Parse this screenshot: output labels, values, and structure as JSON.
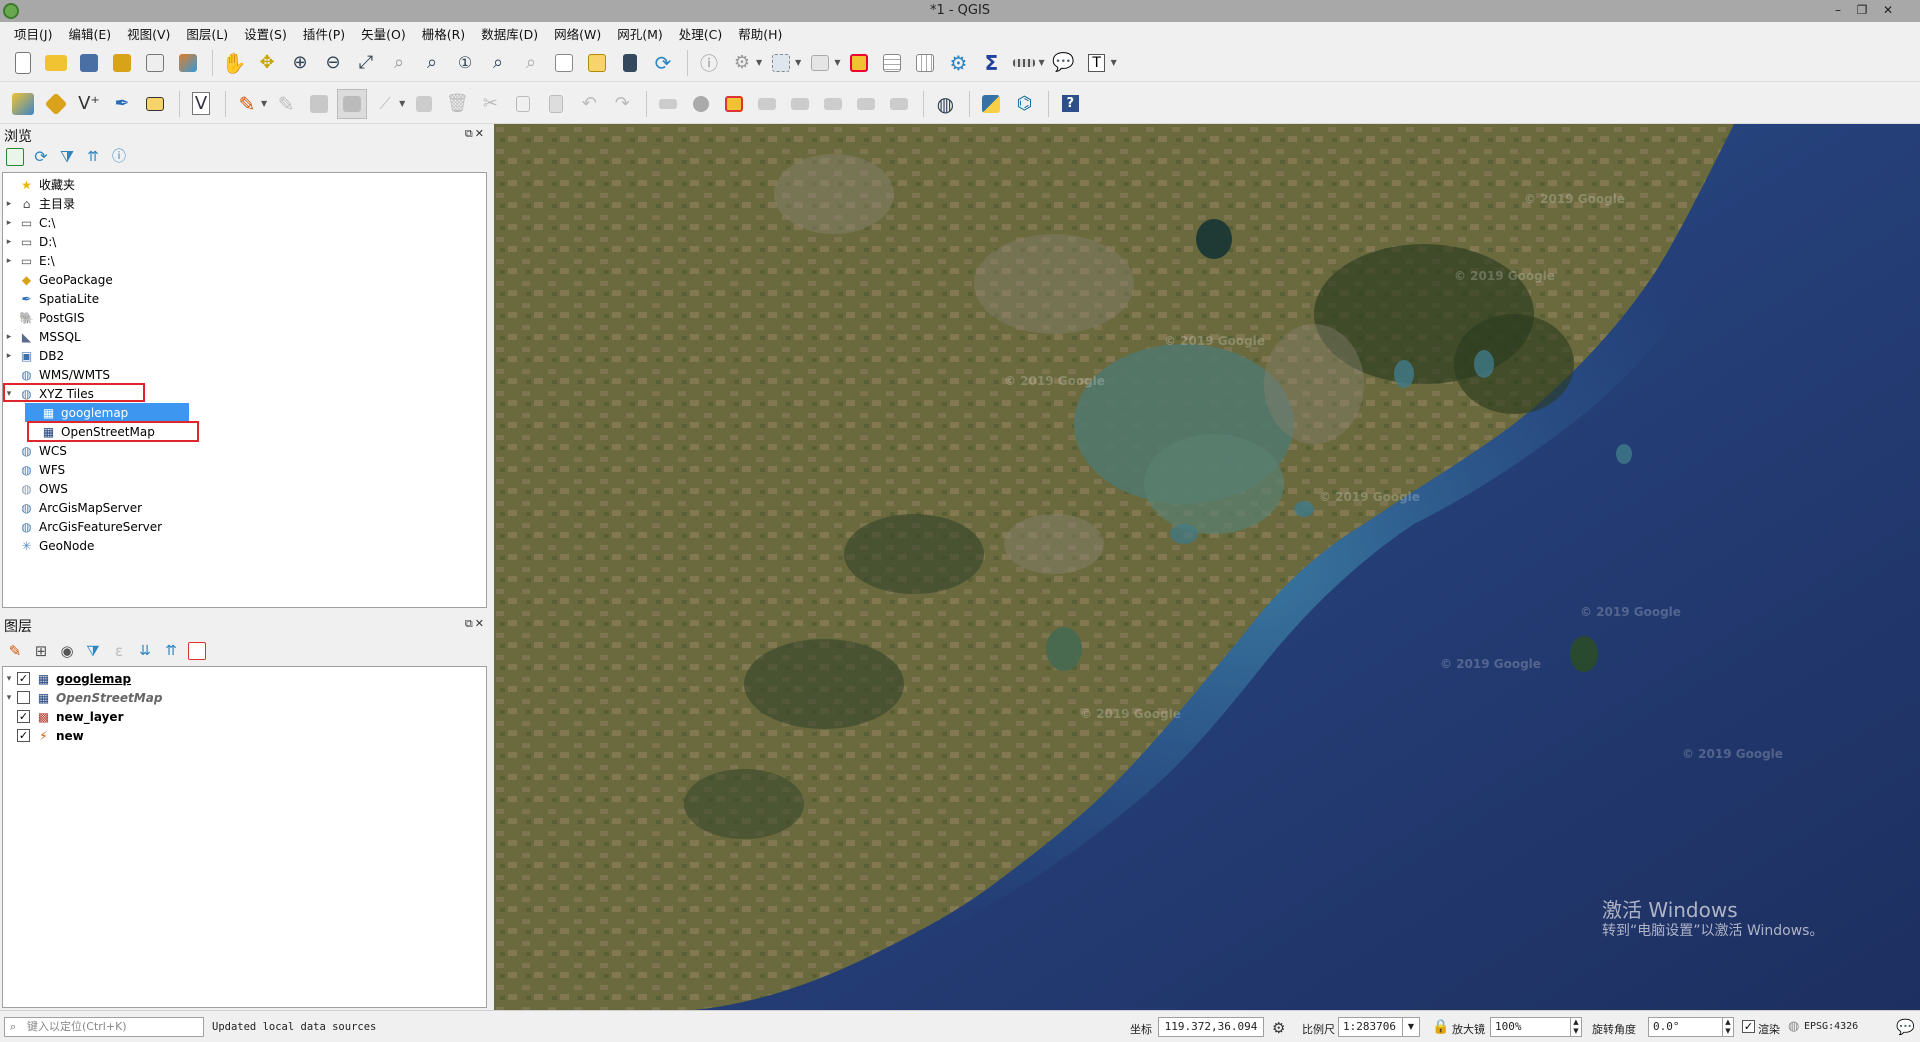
{
  "window": {
    "title": "*1 - QGIS",
    "minimize": "–",
    "restore": "❐",
    "close": "✕"
  },
  "menu": [
    "项目(J)",
    "编辑(E)",
    "视图(V)",
    "图层(L)",
    "设置(S)",
    "插件(P)",
    "矢量(O)",
    "栅格(R)",
    "数据库(D)",
    "网络(W)",
    "网孔(M)",
    "处理(C)",
    "帮助(H)"
  ],
  "browser": {
    "title": "浏览",
    "controls": "⧉✕",
    "items": [
      {
        "label": "收藏夹",
        "icon": "star-icon",
        "glyph": "★",
        "color": "#e6b800",
        "arrow": ""
      },
      {
        "label": "主目录",
        "icon": "home-folder-icon",
        "glyph": "⌂",
        "color": "#555",
        "arrow": "▸"
      },
      {
        "label": "C:\\",
        "icon": "folder-icon",
        "glyph": "▭",
        "color": "#555",
        "arrow": "▸"
      },
      {
        "label": "D:\\",
        "icon": "folder-icon",
        "glyph": "▭",
        "color": "#555",
        "arrow": "▸"
      },
      {
        "label": "E:\\",
        "icon": "folder-icon",
        "glyph": "▭",
        "color": "#555",
        "arrow": "▸"
      },
      {
        "label": "GeoPackage",
        "icon": "geopackage-icon",
        "glyph": "◆",
        "color": "#d9a21b",
        "arrow": ""
      },
      {
        "label": "SpatiaLite",
        "icon": "spatialite-icon",
        "glyph": "✒",
        "color": "#2a6bb5",
        "arrow": ""
      },
      {
        "label": "PostGIS",
        "icon": "postgis-icon",
        "glyph": "🐘",
        "color": "#336791",
        "arrow": ""
      },
      {
        "label": "MSSQL",
        "icon": "mssql-icon",
        "glyph": "◣",
        "color": "#5a6b8c",
        "arrow": "▸"
      },
      {
        "label": "DB2",
        "icon": "db2-icon",
        "glyph": "▣",
        "color": "#3a6fb0",
        "arrow": "▸"
      },
      {
        "label": "WMS/WMTS",
        "icon": "globe-icon",
        "glyph": "◍",
        "color": "#4a7fb5",
        "arrow": ""
      },
      {
        "label": "XYZ Tiles",
        "icon": "globe-icon",
        "glyph": "◍",
        "color": "#4a7fb5",
        "arrow": "▾"
      },
      {
        "label": "googlemap",
        "icon": "tile-layer-icon",
        "glyph": "▦",
        "color": "#1c3f7a",
        "arrow": "",
        "indent": 1
      },
      {
        "label": "OpenStreetMap",
        "icon": "tile-layer-icon",
        "glyph": "▦",
        "color": "#1c3f7a",
        "arrow": "",
        "indent": 1
      },
      {
        "label": "WCS",
        "icon": "globe-icon",
        "glyph": "◍",
        "color": "#4a7fb5",
        "arrow": ""
      },
      {
        "label": "WFS",
        "icon": "globe-icon",
        "glyph": "◍",
        "color": "#4a7fb5",
        "arrow": ""
      },
      {
        "label": "OWS",
        "icon": "globe-icon",
        "glyph": "◍",
        "color": "#8a9cb0",
        "arrow": ""
      },
      {
        "label": "ArcGisMapServer",
        "icon": "globe-icon",
        "glyph": "◍",
        "color": "#4a7fb5",
        "arrow": ""
      },
      {
        "label": "ArcGisFeatureServer",
        "icon": "globe-icon",
        "glyph": "◍",
        "color": "#4a7fb5",
        "arrow": ""
      },
      {
        "label": "GeoNode",
        "icon": "geonode-icon",
        "glyph": "✳",
        "color": "#5a8fc8",
        "arrow": ""
      }
    ]
  },
  "layers": {
    "title": "图层",
    "controls": "⧉✕",
    "items": [
      {
        "label": "googlemap",
        "checked": true,
        "icon": "tile-layer-icon",
        "glyph": "▦",
        "color": "#1c3f7a",
        "bold": true,
        "underline": true,
        "italic": false,
        "arrow": "▾"
      },
      {
        "label": "OpenStreetMap",
        "checked": false,
        "icon": "tile-layer-icon",
        "glyph": "▦",
        "color": "#1c3f7a",
        "bold": true,
        "underline": false,
        "italic": true,
        "arrow": "▾"
      },
      {
        "label": "new_layer",
        "checked": true,
        "icon": "polygon-layer-icon",
        "glyph": "▩",
        "color": "#b03a2e",
        "bold": true,
        "underline": false,
        "italic": false,
        "arrow": ""
      },
      {
        "label": "new",
        "checked": true,
        "icon": "line-layer-icon",
        "glyph": "⚡",
        "color": "#d35400",
        "bold": true,
        "underline": false,
        "italic": false,
        "arrow": ""
      }
    ]
  },
  "map": {
    "watermarks": [
      "© 2019 Google",
      "© 2019 Google",
      "© 2019 Google",
      "© 2019 Google",
      "© 2019 Google",
      "© 2019 Google",
      "© 2019 Google",
      "© 2019 Google",
      "© 2019 Google"
    ],
    "activation_title": "激活 Windows",
    "activation_sub": "转到“电脑设置”以激活 Windows。"
  },
  "status": {
    "locator_placeholder": "键入以定位(Ctrl+K)",
    "message": "Updated local data sources",
    "coord_label": "坐标",
    "coord_value": "119.372,36.094",
    "scale_label": "比例尺",
    "scale_value": "1:283706",
    "magnifier_label": "放大镜",
    "magnifier_value": "100%",
    "rotation_label": "旋转角度",
    "rotation_value": "0.0°",
    "render_label": "渲染",
    "crs": "EPSG:4326"
  }
}
